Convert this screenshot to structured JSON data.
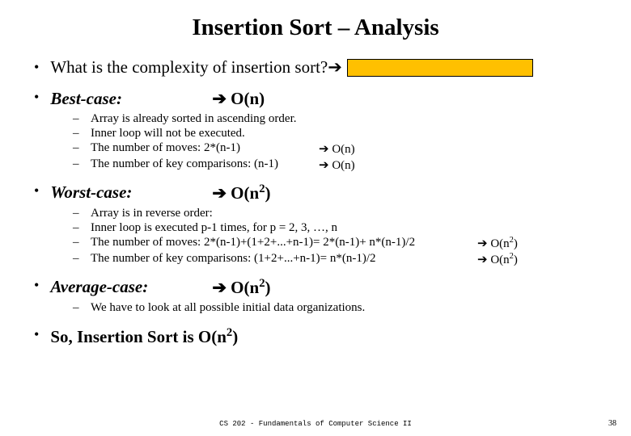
{
  "title": "Insertion Sort – Analysis",
  "question": {
    "text": "What is the complexity of insertion sort? ",
    "arrow": "➔"
  },
  "best": {
    "label": "Best-case:",
    "arrow": "➔",
    "complexity": " O(n)",
    "items": [
      {
        "text": "Array is already sorted in ascending order."
      },
      {
        "text": "Inner loop will not be executed."
      },
      {
        "text": "The number of moves: 2*(n-1)",
        "result_arrow": "➔",
        "result": " O(n)"
      },
      {
        "text": "The number of key comparisons: (n-1)",
        "result_arrow": "➔",
        "result": " O(n)"
      }
    ]
  },
  "worst": {
    "label": "Worst-case:",
    "arrow": "➔",
    "complexity_prefix": " O(n",
    "complexity_exp": "2",
    "complexity_suffix": ")",
    "items": [
      {
        "text": "Array is in reverse order:"
      },
      {
        "text": "Inner loop is executed p-1 times, for p = 2, 3, …, n"
      },
      {
        "text": "The number of moves: 2*(n-1)+(1+2+...+n-1)= 2*(n-1)+ n*(n-1)/2",
        "result_arrow": "➔",
        "result_prefix": " O(n",
        "result_exp": "2",
        "result_suffix": ")"
      },
      {
        "text": "The number of key comparisons: (1+2+...+n-1)= n*(n-1)/2",
        "result_arrow": "➔",
        "result_prefix": " O(n",
        "result_exp": "2",
        "result_suffix": ")"
      }
    ]
  },
  "average": {
    "label": "Average-case:",
    "arrow": "➔",
    "complexity_prefix": " O(n",
    "complexity_exp": "2",
    "complexity_suffix": ")",
    "note": "We have to look at all possible initial data organizations."
  },
  "conclusion": {
    "prefix": "So, Insertion Sort is O(n",
    "exp": "2",
    "suffix": ")"
  },
  "footer": "CS 202 - Fundamentals of Computer Science II",
  "page": "38",
  "dash": "–",
  "bullet": "•"
}
